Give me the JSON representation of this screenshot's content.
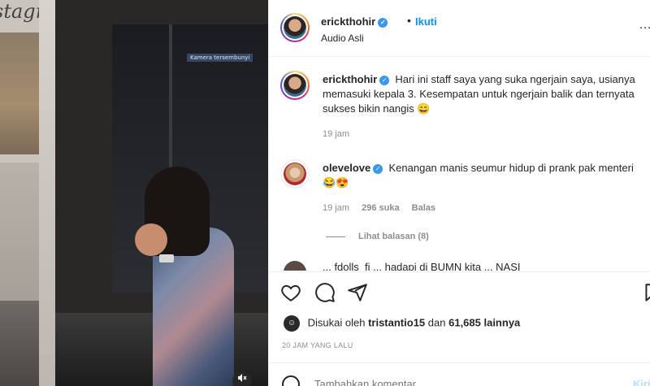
{
  "background": {
    "logo_text": "stagra"
  },
  "media": {
    "camera_label": "Kamera tersembunyi",
    "mute_icon": "speaker-muted-icon"
  },
  "post": {
    "author": "erickthohir",
    "follow_label": "Ikuti",
    "audio": "Audio Asli",
    "caption": "Hari ini staff saya yang suka ngerjain saya, usianya memasuki kepala 3. Kesempatan untuk ngerjain balik dan ternyata sukses bikin nangis 😄",
    "caption_time": "19 jam"
  },
  "comments": [
    {
      "user": "olevelove",
      "text": "Kenangan manis seumur hidup di prank pak menteri 😂😍",
      "time": "19 jam",
      "likes": "296 suka",
      "reply_label": "Balas",
      "view_replies": "Lihat balasan (8)"
    }
  ],
  "cut_comment": {
    "text": "... fdolls_fi ... hadapi di BUMN kita ... NASI"
  },
  "liked_by": {
    "prefix": "Disukai oleh",
    "user": "tristantio15",
    "middle": "dan",
    "others": "61,685 lainnya"
  },
  "date": "20 JAM YANG LALU",
  "add_comment": {
    "placeholder": "Tambahkan komentar...",
    "post_label": "Kirim"
  },
  "colors": {
    "accent": "#0095f6",
    "verified": "#3897f0",
    "muted_text": "#8e8e8e"
  }
}
